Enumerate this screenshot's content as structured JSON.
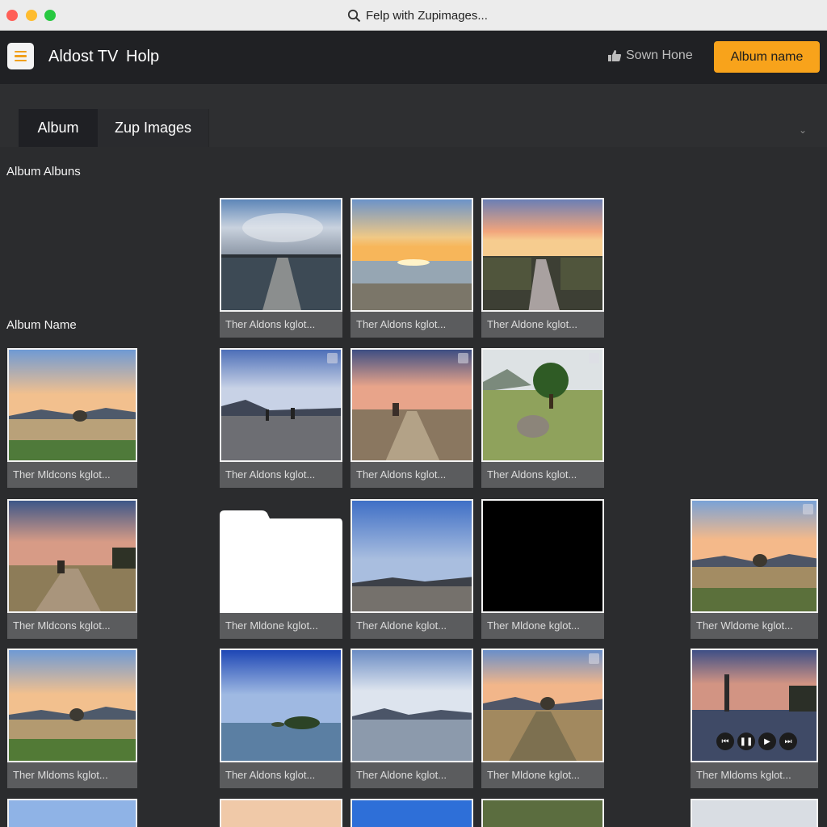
{
  "window": {
    "title": "Felp with Zupimages..."
  },
  "appbar": {
    "app_title": "Aldost TV",
    "help": "Holp",
    "sown_label": "Sown Hone",
    "album_button": "Album name"
  },
  "tabs": [
    {
      "label": "Album"
    },
    {
      "label": "Zup Images"
    }
  ],
  "sections": {
    "albums": "Album Albuns",
    "album_name": "Album Name"
  },
  "tiles": [
    {
      "caption": "Ther Aldons kglot..."
    },
    {
      "caption": "Ther Aldons kglot..."
    },
    {
      "caption": "Ther Aldone kglot..."
    },
    {
      "caption": "Ther Mldcons kglot..."
    },
    {
      "caption": "Ther Aldons kglot..."
    },
    {
      "caption": "Ther Aldons kglot..."
    },
    {
      "caption": "Ther Aldons kglot..."
    },
    {
      "caption": "Ther Mldcons kglot..."
    },
    {
      "caption": "Ther Mldone kglot..."
    },
    {
      "caption": "Ther Aldone kglot..."
    },
    {
      "caption": "Ther Mldone kglot..."
    },
    {
      "caption": "Ther Wldome kglot..."
    },
    {
      "caption": "Ther Mldoms kglot..."
    },
    {
      "caption": "Ther Aldons kglot..."
    },
    {
      "caption": "Ther Aldone kglot..."
    },
    {
      "caption": "Ther Mldone kglot..."
    },
    {
      "caption": "Ther Mldoms kglot..."
    }
  ],
  "icons": {
    "search": "search-icon",
    "menu": "hamburger-menu-icon",
    "sown": "thumbs-up-icon",
    "chevron": "chevron-down-icon",
    "player": [
      "skip-back-icon",
      "pause-icon",
      "play-icon",
      "skip-forward-icon"
    ]
  },
  "colors": {
    "accent": "#f8a31b",
    "background": "#2b2c2e",
    "header": "#202124"
  }
}
